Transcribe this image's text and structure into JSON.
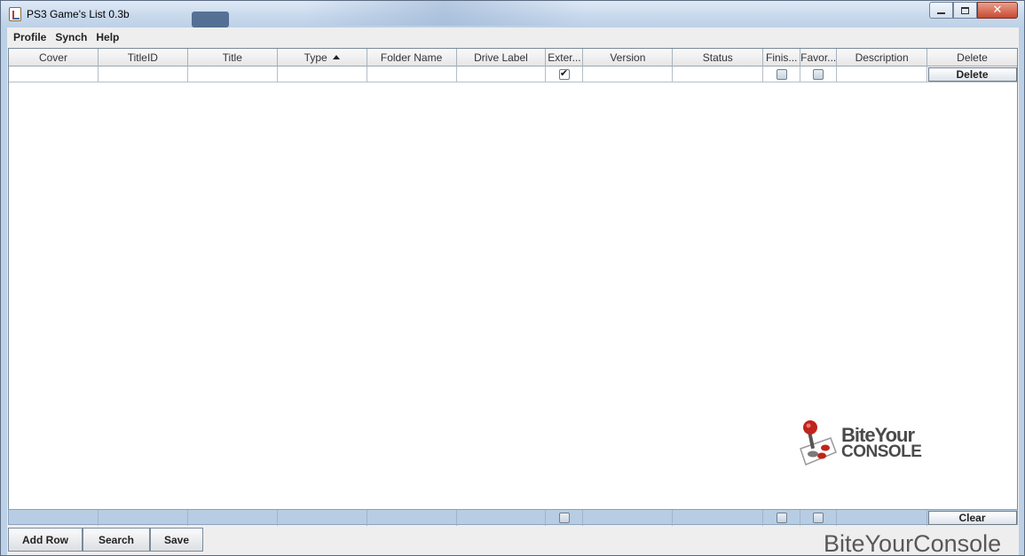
{
  "window": {
    "title": "PS3 Game's List 0.3b"
  },
  "menu": [
    "Profile",
    "Synch",
    "Help"
  ],
  "table": {
    "columns": [
      "Cover",
      "TitleID",
      "Title",
      "Type",
      "Folder Name",
      "Drive Label",
      "Exter...",
      "Version",
      "Status",
      "Finis...",
      "Favor...",
      "Description",
      "Delete"
    ],
    "sorted_column": "Type",
    "row": {
      "external_checked": true,
      "finished_checked": false,
      "favorite_checked": false,
      "delete_label": "Delete"
    },
    "filter": {
      "clear_label": "Clear"
    }
  },
  "logo": {
    "line1": "BiteYour",
    "line2": "CONSOLE"
  },
  "buttons": {
    "add_row": "Add Row",
    "search": "Search",
    "save": "Save"
  },
  "watermark": "BiteYourConsole",
  "colors": {
    "filter_row": "#b6cde4",
    "close_button": "#c74a31"
  }
}
